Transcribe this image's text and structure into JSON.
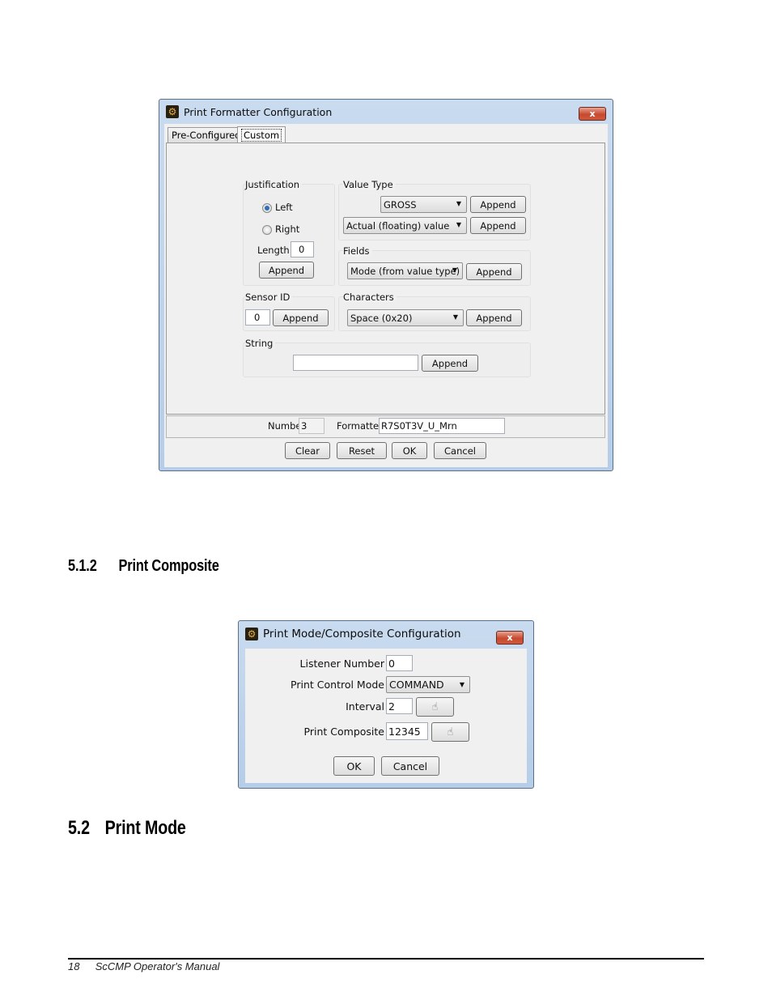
{
  "dialog1": {
    "title": "Print Formatter Configuration",
    "close_label": "x",
    "tabs": [
      {
        "label": "Pre-Configured",
        "active": false
      },
      {
        "label": "Custom",
        "active": true
      }
    ],
    "justification": {
      "title": "Justification",
      "left_label": "Left",
      "right_label": "Right",
      "selected": "Left",
      "length_label": "Length",
      "length_value": "0",
      "append_label": "Append"
    },
    "value_type": {
      "title": "Value Type",
      "combo1_value": "GROSS",
      "combo2_value": "Actual (floating) value",
      "append1_label": "Append",
      "append2_label": "Append"
    },
    "fields": {
      "title": "Fields",
      "combo_value": "Mode (from value type)",
      "append_label": "Append"
    },
    "sensor_id": {
      "title": "Sensor ID",
      "value": "0",
      "append_label": "Append"
    },
    "characters": {
      "title": "Characters",
      "combo_value": "Space (0x20)",
      "append_label": "Append"
    },
    "string": {
      "title": "String",
      "value": "",
      "append_label": "Append"
    },
    "status": {
      "number_label": "Number",
      "number_value": "3",
      "formatter_label": "Formatter",
      "formatter_value": "R7S0T3V_U_Mrn"
    },
    "buttons": {
      "clear": "Clear",
      "reset": "Reset",
      "ok": "OK",
      "cancel": "Cancel"
    }
  },
  "section_512": {
    "number": "5.1.2",
    "title": "Print Composite"
  },
  "dialog2": {
    "title": "Print Mode/Composite Configuration",
    "close_label": "x",
    "listener_label": "Listener Number",
    "listener_value": "0",
    "print_control_label": "Print Control Mode",
    "print_control_value": "COMMAND",
    "interval_label": "Interval",
    "interval_value": "2",
    "composite_label": "Print Composite",
    "composite_value": "12345",
    "ok": "OK",
    "cancel": "Cancel"
  },
  "section_52": {
    "number": "5.2",
    "title": "Print Mode"
  },
  "footer": {
    "page_number": "18",
    "manual_title": "ScCMP Operator's Manual"
  }
}
